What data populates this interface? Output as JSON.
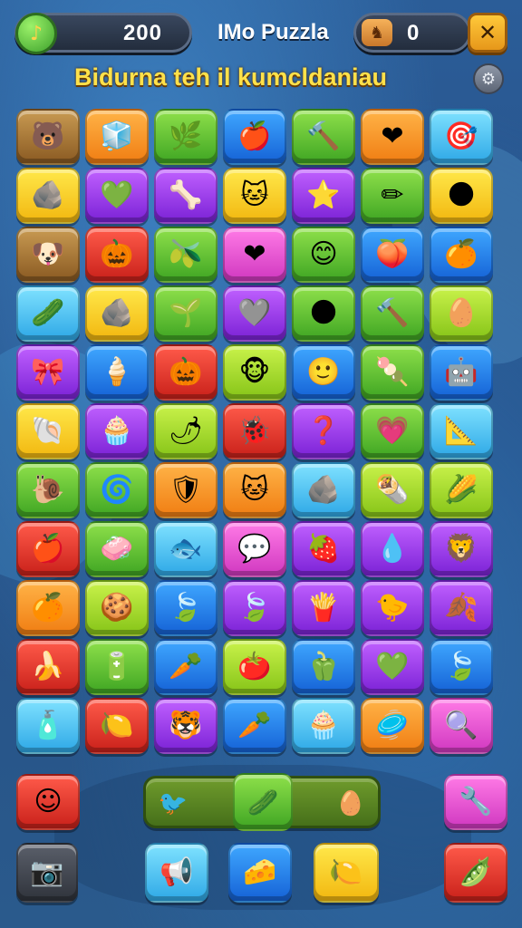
{
  "hud": {
    "score": "200",
    "score_icon": "♪",
    "title": "IMo Puzzla",
    "lives": "0",
    "lives_icon": "♞",
    "close_label": "✕"
  },
  "subtitle": "Bidurna teh il kumcldaniau",
  "settings_icon": "⚙",
  "grid": [
    [
      {
        "c": "brown",
        "g": "🐻"
      },
      {
        "c": "orange",
        "g": "🧊"
      },
      {
        "c": "green",
        "g": "🌿"
      },
      {
        "c": "blue",
        "g": "🍎"
      },
      {
        "c": "green",
        "g": "🔨"
      },
      {
        "c": "orange",
        "g": "❤"
      },
      {
        "c": "cyan",
        "g": "🎯"
      }
    ],
    [
      {
        "c": "yellow",
        "g": "🪨"
      },
      {
        "c": "purple",
        "g": "💚"
      },
      {
        "c": "purple",
        "g": "🦴"
      },
      {
        "c": "yellow",
        "g": "🐱"
      },
      {
        "c": "purple",
        "g": "⭐"
      },
      {
        "c": "green",
        "g": "✏"
      },
      {
        "c": "yellow",
        "g": "🌑"
      }
    ],
    [
      {
        "c": "brown",
        "g": "🐶"
      },
      {
        "c": "red",
        "g": "🎃"
      },
      {
        "c": "green",
        "g": "🫒"
      },
      {
        "c": "pink",
        "g": "❤"
      },
      {
        "c": "green",
        "g": "😊"
      },
      {
        "c": "blue",
        "g": "🍑"
      },
      {
        "c": "blue",
        "g": "🍊"
      }
    ],
    [
      {
        "c": "cyan",
        "g": "🥒"
      },
      {
        "c": "yellow",
        "g": "🪨"
      },
      {
        "c": "green",
        "g": "🌱"
      },
      {
        "c": "purple",
        "g": "🩶"
      },
      {
        "c": "green",
        "g": "🌑"
      },
      {
        "c": "green",
        "g": "🔨"
      },
      {
        "c": "lime",
        "g": "🥚"
      }
    ],
    [
      {
        "c": "purple",
        "g": "🎀"
      },
      {
        "c": "blue",
        "g": "🍦"
      },
      {
        "c": "red",
        "g": "🎃"
      },
      {
        "c": "lime",
        "g": "🐵"
      },
      {
        "c": "blue",
        "g": "🙂"
      },
      {
        "c": "green",
        "g": "🍡"
      },
      {
        "c": "blue",
        "g": "🤖"
      }
    ],
    [
      {
        "c": "yellow",
        "g": "🐚"
      },
      {
        "c": "purple",
        "g": "🧁"
      },
      {
        "c": "lime",
        "g": "🌶"
      },
      {
        "c": "red",
        "g": "🐞"
      },
      {
        "c": "purple",
        "g": "❓"
      },
      {
        "c": "green",
        "g": "💗"
      },
      {
        "c": "cyan",
        "g": "📐"
      }
    ],
    [
      {
        "c": "green",
        "g": "🐌"
      },
      {
        "c": "green",
        "g": "🌀"
      },
      {
        "c": "orange",
        "g": "🛡"
      },
      {
        "c": "orange",
        "g": "🐱"
      },
      {
        "c": "cyan",
        "g": "🪨"
      },
      {
        "c": "lime",
        "g": "🌯"
      },
      {
        "c": "lime",
        "g": "🌽"
      }
    ],
    [
      {
        "c": "red",
        "g": "🍎"
      },
      {
        "c": "green",
        "g": "🧼"
      },
      {
        "c": "cyan",
        "g": "🐟"
      },
      {
        "c": "pink",
        "g": "💬"
      },
      {
        "c": "purple",
        "g": "🍓"
      },
      {
        "c": "purple",
        "g": "💧"
      },
      {
        "c": "purple",
        "g": "🦁"
      }
    ],
    [
      {
        "c": "orange",
        "g": "🍊"
      },
      {
        "c": "lime",
        "g": "🍪"
      },
      {
        "c": "blue",
        "g": "🍃"
      },
      {
        "c": "purple",
        "g": "🍃"
      },
      {
        "c": "purple",
        "g": "🍟"
      },
      {
        "c": "purple",
        "g": "🐤"
      },
      {
        "c": "purple",
        "g": "🍂"
      }
    ],
    [
      {
        "c": "red",
        "g": "🍌"
      },
      {
        "c": "green",
        "g": "🔋"
      },
      {
        "c": "blue",
        "g": "🥕"
      },
      {
        "c": "lime",
        "g": "🍅"
      },
      {
        "c": "blue",
        "g": "🫑"
      },
      {
        "c": "purple",
        "g": "💚"
      },
      {
        "c": "blue",
        "g": "🍃"
      }
    ],
    [
      {
        "c": "cyan",
        "g": "🧴"
      },
      {
        "c": "red",
        "g": "🍋"
      },
      {
        "c": "purple",
        "g": "🐯"
      },
      {
        "c": "blue",
        "g": "🥕"
      },
      {
        "c": "cyan",
        "g": "🧁"
      },
      {
        "c": "orange",
        "g": "🥏"
      },
      {
        "c": "pink",
        "g": "🔍"
      }
    ]
  ],
  "bottom": {
    "left_tile": {
      "c": "red",
      "g": "☺"
    },
    "tray_left": "🐦",
    "tray_center": "🥒",
    "tray_right": "🥚",
    "right_tile": {
      "c": "pink",
      "g": "🔧"
    },
    "camera_tile": {
      "c": "dark",
      "g": "📷"
    },
    "b1": {
      "c": "cyan",
      "g": "📢"
    },
    "b2": {
      "c": "blue",
      "g": "🧀"
    },
    "b3": {
      "c": "yellow",
      "g": "🍋"
    },
    "b4": {
      "c": "red",
      "g": "🫛"
    }
  }
}
